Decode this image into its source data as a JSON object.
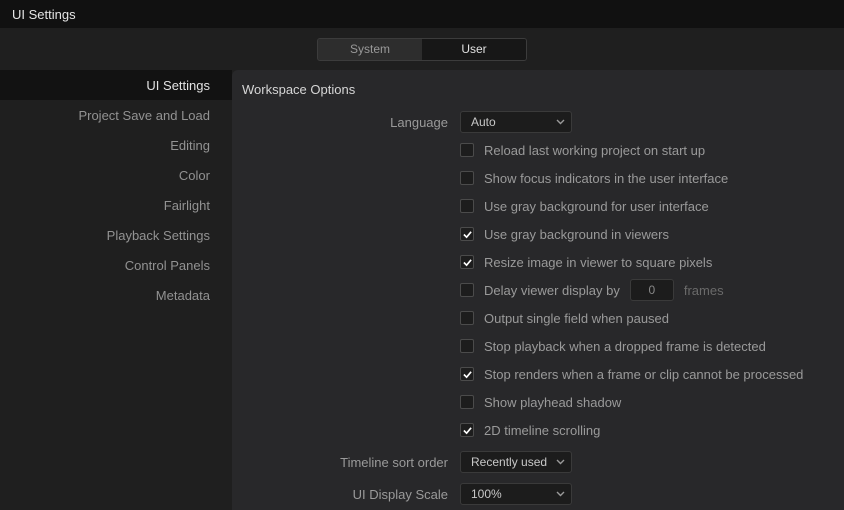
{
  "title": "UI Settings",
  "top_tabs": {
    "system": "System",
    "user": "User"
  },
  "sidebar": {
    "items": [
      {
        "label": "UI Settings"
      },
      {
        "label": "Project Save and Load"
      },
      {
        "label": "Editing"
      },
      {
        "label": "Color"
      },
      {
        "label": "Fairlight"
      },
      {
        "label": "Playback Settings"
      },
      {
        "label": "Control Panels"
      },
      {
        "label": "Metadata"
      }
    ]
  },
  "content": {
    "header": "Workspace Options",
    "language_label": "Language",
    "language_value": "Auto",
    "checks": {
      "reload": "Reload last working project on start up",
      "focus_indicators": "Show focus indicators in the user interface",
      "gray_ui": "Use gray background for user interface",
      "gray_viewers": "Use gray background in viewers",
      "resize_square": "Resize image in viewer to square pixels",
      "delay_display": "Delay viewer display by",
      "delay_frames_value": "0",
      "delay_frames_unit": "frames",
      "output_single": "Output single field when paused",
      "stop_dropped": "Stop playback when a dropped frame is detected",
      "stop_renders": "Stop renders when a frame or clip cannot be processed",
      "playhead_shadow": "Show playhead shadow",
      "timeline_scroll": "2D timeline scrolling"
    },
    "sort_label": "Timeline sort order",
    "sort_value": "Recently used",
    "scale_label": "UI Display Scale",
    "scale_value": "100%"
  }
}
